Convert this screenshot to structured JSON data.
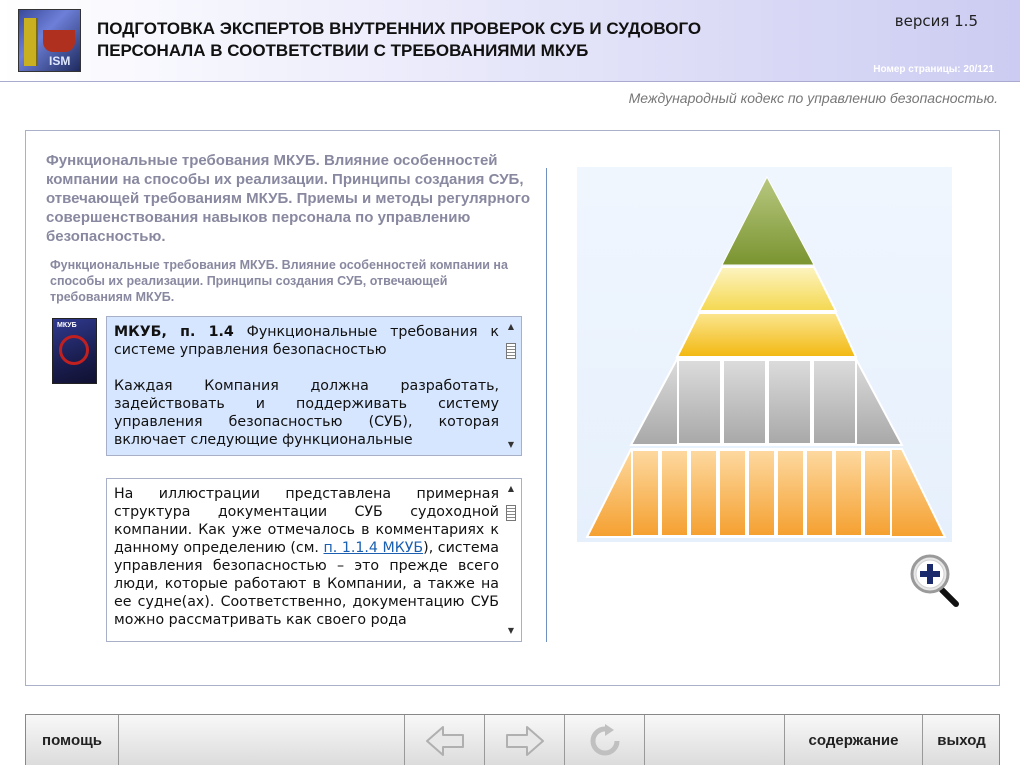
{
  "header": {
    "title": "ПОДГОТОВКА ЭКСПЕРТОВ ВНУТРЕННИХ ПРОВЕРОК СУБ И СУДОВОГО ПЕРСОНАЛА В СООТВЕТСТВИИ С ТРЕБОВАНИЯМИ МКУБ",
    "version": "версия 1.5",
    "page_number": "Номер страницы: 20/121",
    "logo_text": "ISM"
  },
  "subtitle": "Международный кодекс по управлению безопасностью.",
  "content": {
    "heading": "Функциональные требования МКУБ. Влияние особенностей компании на способы их реализации. Принципы создания СУБ, отвечающей требованиям МКУБ. Приемы и методы регулярного совершенствования навыков персонала по управлению безопасностью.",
    "subheading": "Функциональные требования МКУБ. Влияние особенностей компании на способы их реализации. Принципы создания СУБ, отвечающей требованиям МКУБ.",
    "book_thumb_text": "МКУБ",
    "box1": {
      "bold": "МКУБ, п. 1.4",
      "title_rest": " Функциональные требования к системе управления безопасностью",
      "para": "Каждая Компания должна разработать, задействовать и поддерживать систему управления безопасностью (СУБ), которая включает следующие функциональные"
    },
    "box2": {
      "text_before": "На иллюстрации представлена примерная структура документации СУБ судоходной компании. Как уже отмечалось в комментариях к данному определению (см. ",
      "link": "п. 1.1.4 МКУБ",
      "text_after": "), система управления безопасностью – это прежде всего люди, которые работают в Компании, а также на ее судне(ах). Соответственно, документацию СУБ можно рассматривать как своего рода"
    }
  },
  "footer": {
    "help": "помощь",
    "contents": "содержание",
    "exit": "выход"
  },
  "colors": {
    "pyramid_top": "#8aa040",
    "pyramid_yellow": "#f6e070",
    "pyramid_gold": "#f4c020",
    "pyramid_gray": "#b8b8b8",
    "pyramid_orange": "#f8a838",
    "link": "#1a5fb0"
  },
  "icons": {
    "back": "arrow-left-icon",
    "forward": "arrow-right-icon",
    "reload": "refresh-icon",
    "zoom": "zoom-in-icon"
  }
}
